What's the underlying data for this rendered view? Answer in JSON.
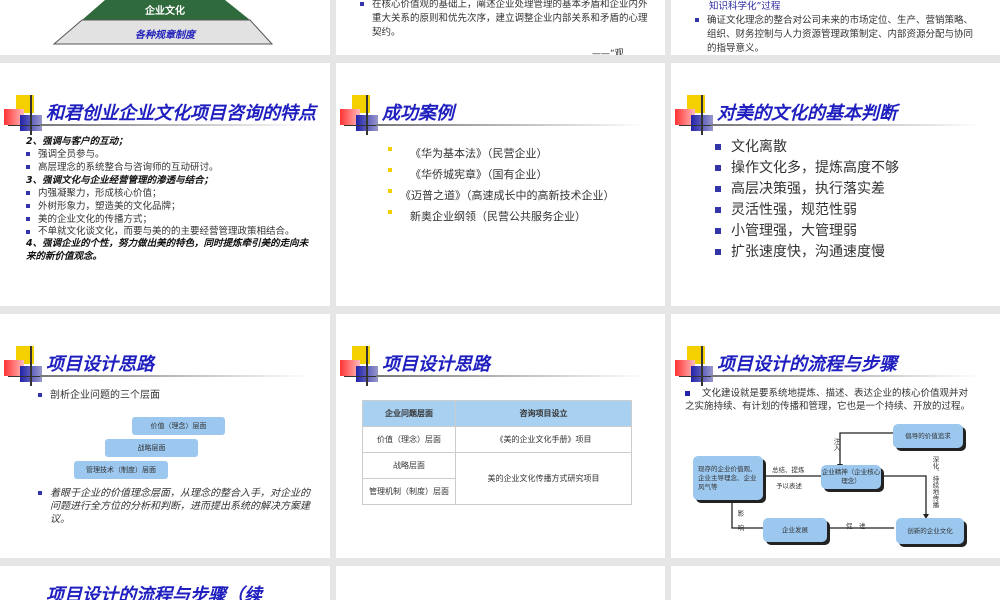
{
  "slides": {
    "s1": {
      "apex": "企业文化",
      "base": "各种规章制度"
    },
    "s2": {
      "text": "在核心价值观的基础上，阐述企业处理管理的基本矛盾和企业内外重大关系的原则和优先次序，建立调整企业内部关系和矛盾的心理契约。",
      "quote": "——“观"
    },
    "s3": {
      "line0": "知识科学化”过程",
      "text": "确证文化理念的整合对公司未来的市场定位、生产、营销策略、组织、财务控制与人力资源管理政策制定、内部资源分配与协同的指导意义。"
    },
    "s4": {
      "title": "和君创业企业文化项目咨询的特点",
      "items": [
        {
          "h": true,
          "t": "2、强调与客户的互动；"
        },
        {
          "t": "强调全员参与。"
        },
        {
          "t": "高层理念的系统整合与咨询师的互动研讨。"
        },
        {
          "h": true,
          "t": "3、强调文化与企业经营管理的渗透与结合；"
        },
        {
          "t": "内强凝聚力，形成核心价值；"
        },
        {
          "t": "外树形象力，塑造美的文化品牌；"
        },
        {
          "t": "美的企业文化的传播方式；"
        },
        {
          "t": "不单就文化谈文化，而要与美的的主要经营管理政策相结合。"
        },
        {
          "h": true,
          "t": "4、强调企业的个性，努力做出美的特色，同时提炼牵引美的走向未来的新价值观念。"
        }
      ]
    },
    "s5": {
      "title": "成功案例",
      "items": [
        "《华为基本法》（民营企业）",
        "《华侨城宪章》（国有企业）",
        "《迈普之道》（高速成长中的高新技术企业）",
        "新奥企业纲领（民营公共服务企业）"
      ]
    },
    "s6": {
      "title": "对美的文化的基本判断",
      "items": [
        "文化离散",
        "操作文化多，提炼高度不够",
        "高层决策强，执行落实差",
        "灵活性强，规范性弱",
        "小管理强，大管理弱",
        "扩张速度快，沟通速度慢"
      ]
    },
    "s7": {
      "title": "项目设计思路",
      "bullet": "剖析企业问题的三个层面",
      "layers": [
        "价值（理念）层面",
        "战略层面",
        "管理技术（制度）层面"
      ],
      "note": "着眼于企业的价值理念层面，从理念的整合入手，对企业的问题进行全方位的分析和判断，进而提出系统的解决方案建议。"
    },
    "s8": {
      "title": "项目设计思路",
      "headers": [
        "企业问题层面",
        "咨询项目设立"
      ],
      "rows": [
        "价值（理念）层面",
        "战略层面",
        "管理机制（制度）层面"
      ],
      "proj1": "《美的企业文化手册》项目",
      "proj2": "美的企业文化传播方式研究项目"
    },
    "s9": {
      "title": "项目设计的流程与步骤",
      "text": "文化建设就是要系统地提炼、描述、表达企业的核心价值观并对之实施持续、有计划的传播和管理，它也是一个持续、开放的过程。",
      "boxes": {
        "current": "现存的企业价值观、企业主导理念、企业风气等",
        "spirit": "企业精神（企业核心理念）",
        "pursuit": "倡导的价值追求",
        "innov": "创新的企业文化",
        "dev": "企业发展"
      },
      "labels": {
        "summ1": "总结、提炼",
        "summ2": "予以表述",
        "inject": "注入",
        "spread": "深化、持续地传播",
        "promote": "促　进",
        "affect": "影响"
      }
    },
    "s10": {
      "title": "项目设计的流程与步骤（续"
    }
  }
}
